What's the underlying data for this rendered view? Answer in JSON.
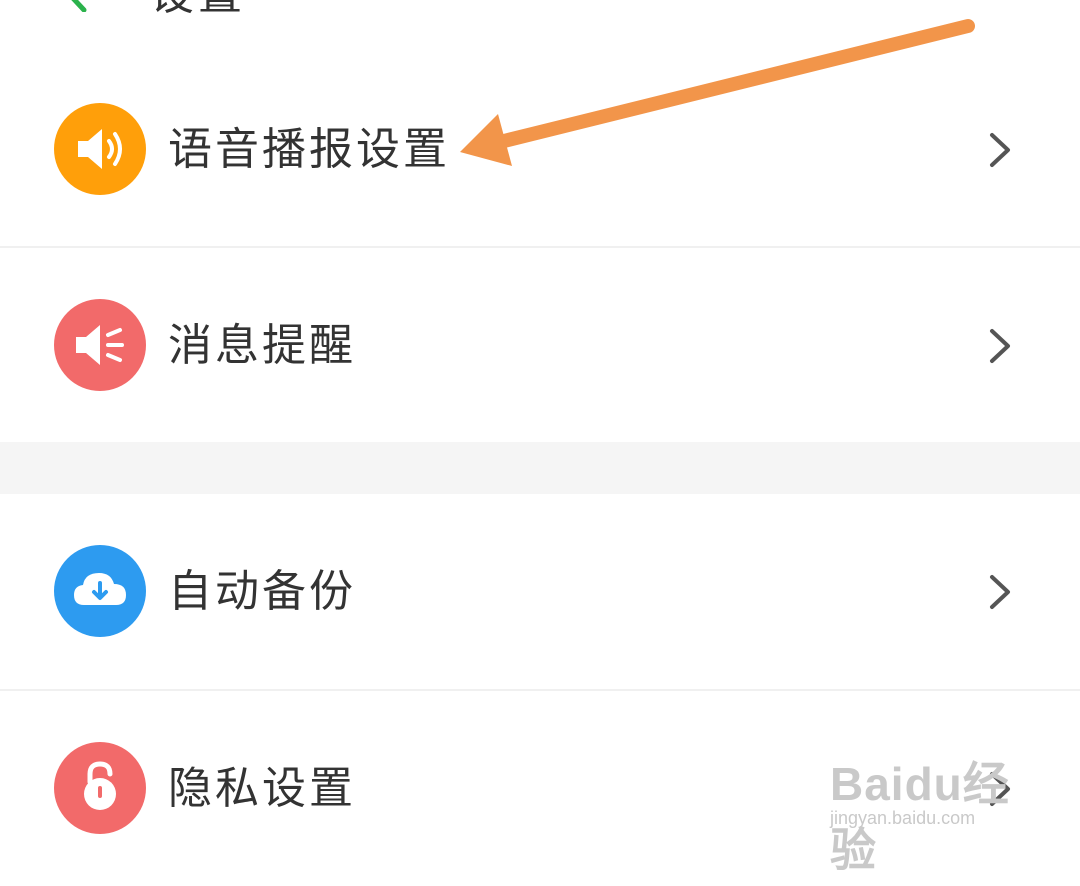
{
  "header": {
    "title": "设置",
    "back_icon": "back-arrow-icon",
    "back_color": "#2bb24c"
  },
  "menu": {
    "items": [
      {
        "label": "语音播报设置",
        "icon": "speaker-icon",
        "icon_color": "#ff9f0a"
      },
      {
        "label": "消息提醒",
        "icon": "megaphone-icon",
        "icon_color": "#f26a6a"
      },
      {
        "label": "自动备份",
        "icon": "cloud-download-icon",
        "icon_color": "#2d9bf0"
      },
      {
        "label": "隐私设置",
        "icon": "lock-icon",
        "icon_color": "#f26a6a"
      }
    ],
    "chevron_icon": "chevron-right-icon"
  },
  "annotation": {
    "color": "#f2954a"
  },
  "watermark": {
    "brand": "Baidu经验",
    "url": "jingyan.baidu.com"
  }
}
